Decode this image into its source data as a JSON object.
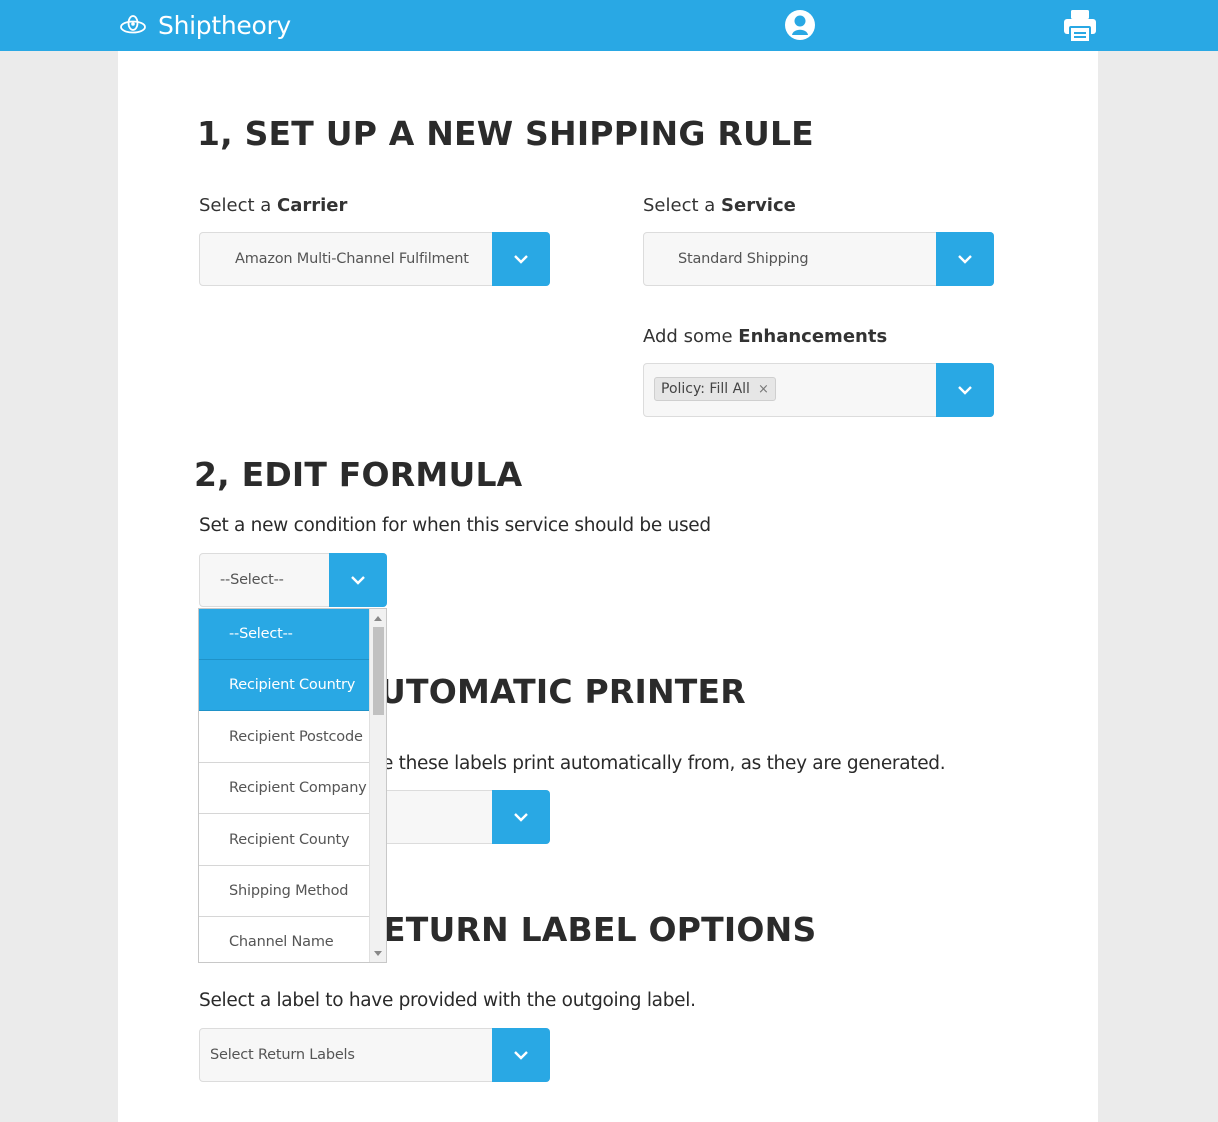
{
  "header": {
    "brand": "Shiptheory",
    "user_icon": "user-icon",
    "print_icon": "printer-icon"
  },
  "section1": {
    "heading": "1, SET UP A NEW SHIPPING RULE",
    "carrier_label_pre": "Select a ",
    "carrier_label_bold": "Carrier",
    "carrier_value": "Amazon Multi-Channel Fulfilment",
    "service_label_pre": "Select a ",
    "service_label_bold": "Service",
    "service_value": "Standard Shipping",
    "enh_label_pre": "Add some ",
    "enh_label_bold": "Enhancements",
    "enh_tag": "Policy: Fill All",
    "enh_tag_remove": "×"
  },
  "section2": {
    "heading": "2, EDIT FORMULA",
    "condition_label": "Set a new condition for when this service should be used",
    "condition_value": "--Select--",
    "options": [
      "--Select--",
      "Recipient Country",
      "Recipient Postcode",
      "Recipient Company",
      "Recipient County",
      "Shipping Method",
      "Channel Name"
    ]
  },
  "section3": {
    "heading_visible": "UTOMATIC PRINTER",
    "description_visible": "e these labels print automatically from, as they are generated."
  },
  "section4": {
    "heading_visible": "ETURN LABEL OPTIONS",
    "label": "Select a label to have provided with the outgoing label.",
    "return_value": "Select Return Labels"
  },
  "colors": {
    "brand": "#29a8e4",
    "background": "#ebebeb",
    "panel": "#ffffff"
  }
}
